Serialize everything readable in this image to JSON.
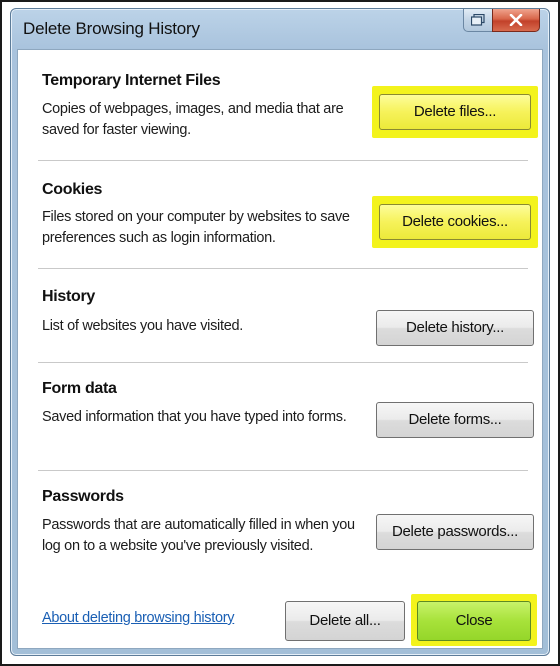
{
  "window": {
    "title": "Delete Browsing History"
  },
  "sections": [
    {
      "title": "Temporary Internet Files",
      "description": "Copies of webpages, images, and media that are saved for faster viewing.",
      "button": "Delete files..."
    },
    {
      "title": "Cookies",
      "description": "Files stored on your computer by websites to save preferences such as login information.",
      "button": "Delete cookies..."
    },
    {
      "title": "History",
      "description": "List of websites you have visited.",
      "button": "Delete history..."
    },
    {
      "title": "Form data",
      "description": "Saved information that you have typed into forms.",
      "button": "Delete forms..."
    },
    {
      "title": "Passwords",
      "description": "Passwords that are automatically filled in when you log on to a website you've previously visited.",
      "button": "Delete passwords..."
    }
  ],
  "footer": {
    "link": "About deleting browsing history",
    "delete_all": "Delete all...",
    "close": "Close"
  },
  "colors": {
    "highlight": "#f3f31c",
    "close_highlight": "#a7e23a",
    "link": "#1a5fb4"
  },
  "icons": {
    "restore": "restore-icon",
    "close": "close-icon"
  }
}
